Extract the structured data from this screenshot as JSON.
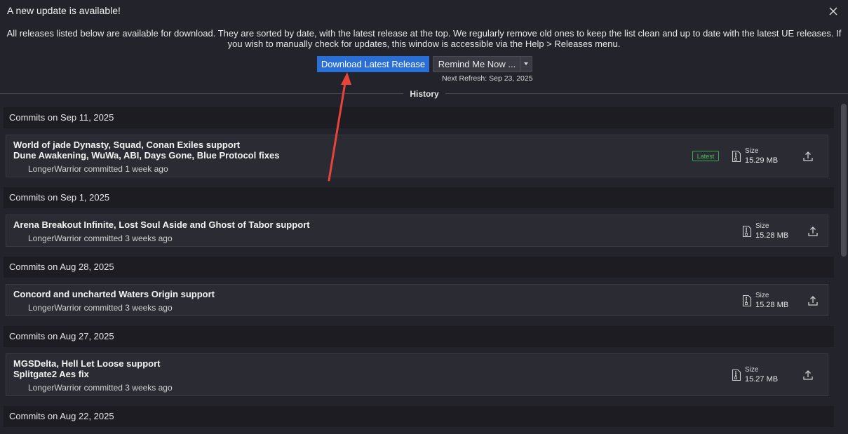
{
  "window": {
    "title": "A new update is available!"
  },
  "description": "All releases listed below are available for download. They are sorted by date, with the latest release at the top. We regularly remove old ones to keep the list clean and up to date with the latest UE releases. If you wish to manually check for updates, this window is accessible via the Help > Releases menu.",
  "actions": {
    "download_label": "Download Latest Release",
    "remind_label": "Remind Me Now ...",
    "next_refresh": "Next Refresh: Sep 23, 2025"
  },
  "history_label": "History",
  "groups": [
    {
      "header": "Commits on Sep 11, 2025",
      "commit": {
        "title_line1": "World of jade Dynasty, Squad, Conan Exiles support",
        "title_line2": "Dune Awakening, WuWa, ABI, Days Gone, Blue Protocol fixes",
        "author": "LongerWarrior committed 1 week ago",
        "badge": "Latest",
        "size_label": "Size",
        "size": "15.29 MB"
      }
    },
    {
      "header": "Commits on Sep 1, 2025",
      "commit": {
        "title_line1": "Arena Breakout Infinite, Lost Soul Aside and Ghost of Tabor support",
        "author": "LongerWarrior committed 3 weeks ago",
        "size_label": "Size",
        "size": "15.28 MB"
      }
    },
    {
      "header": "Commits on Aug 28, 2025",
      "commit": {
        "title_line1": "Concord and uncharted Waters Origin support",
        "author": "LongerWarrior committed 3 weeks ago",
        "size_label": "Size",
        "size": "15.28 MB"
      }
    },
    {
      "header": "Commits on Aug 27, 2025",
      "commit": {
        "title_line1": "MGSDelta, Hell Let Loose support",
        "title_line2": "Splitgate2 Aes fix",
        "author": "LongerWarrior committed 3 weeks ago",
        "size_label": "Size",
        "size": "15.27 MB"
      }
    },
    {
      "header": "Commits on Aug 22, 2025"
    }
  ],
  "colors": {
    "background": "#23232b",
    "primary_button": "#2a6fd6",
    "latest_badge": "#4cc45d",
    "annotation_arrow": "#e8443a"
  },
  "icons": {
    "close": "close-icon",
    "file": "file-zip-icon",
    "upload": "upload-icon",
    "dropdown": "chevron-down-icon"
  }
}
